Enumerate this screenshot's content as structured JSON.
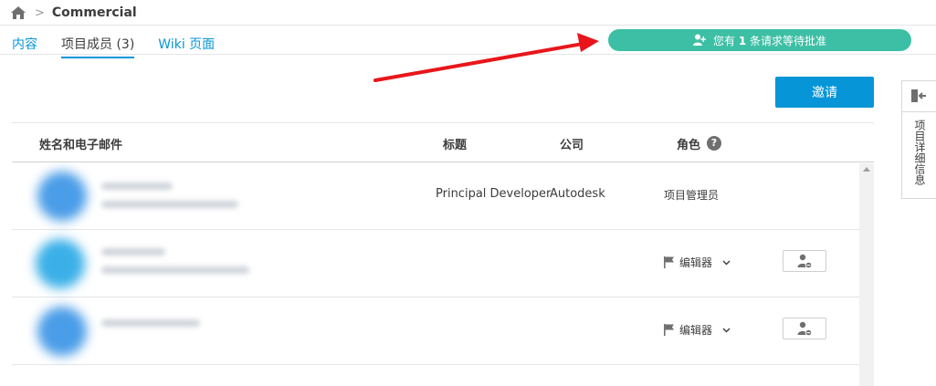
{
  "breadcrumb": {
    "home_icon": "home-icon",
    "separator": ">",
    "title": "Commercial"
  },
  "tabs": [
    {
      "label": "内容",
      "active": false
    },
    {
      "label": "项目成员 (3)",
      "active": true
    },
    {
      "label": "Wiki 页面",
      "active": false
    }
  ],
  "pending": {
    "icon": "person-add-icon",
    "prefix": "您有",
    "count": "1",
    "suffix": "条请求等待批准",
    "color": "#3dbfa5"
  },
  "invite": {
    "label": "邀请",
    "color": "#0696d7"
  },
  "side_panel": {
    "icon": "collapse-panel-icon",
    "label": "项目详细信息"
  },
  "table": {
    "headers": {
      "name": "姓名和电子邮件",
      "title": "标题",
      "company": "公司",
      "role": "角色",
      "help": "?"
    },
    "rows": [
      {
        "avatar_color": "#4a9de8",
        "title": "Principal Developer",
        "company": "Autodesk",
        "role": "项目管理员",
        "role_editable": false
      },
      {
        "avatar_color": "#3bb0e8",
        "title": "",
        "company": "",
        "role": "编辑器",
        "role_editable": true
      },
      {
        "avatar_color": "#4a9de8",
        "title": "",
        "company": "",
        "role": "编辑器",
        "role_editable": true
      }
    ]
  },
  "annotation": {
    "arrow_color": "#e8161b"
  }
}
